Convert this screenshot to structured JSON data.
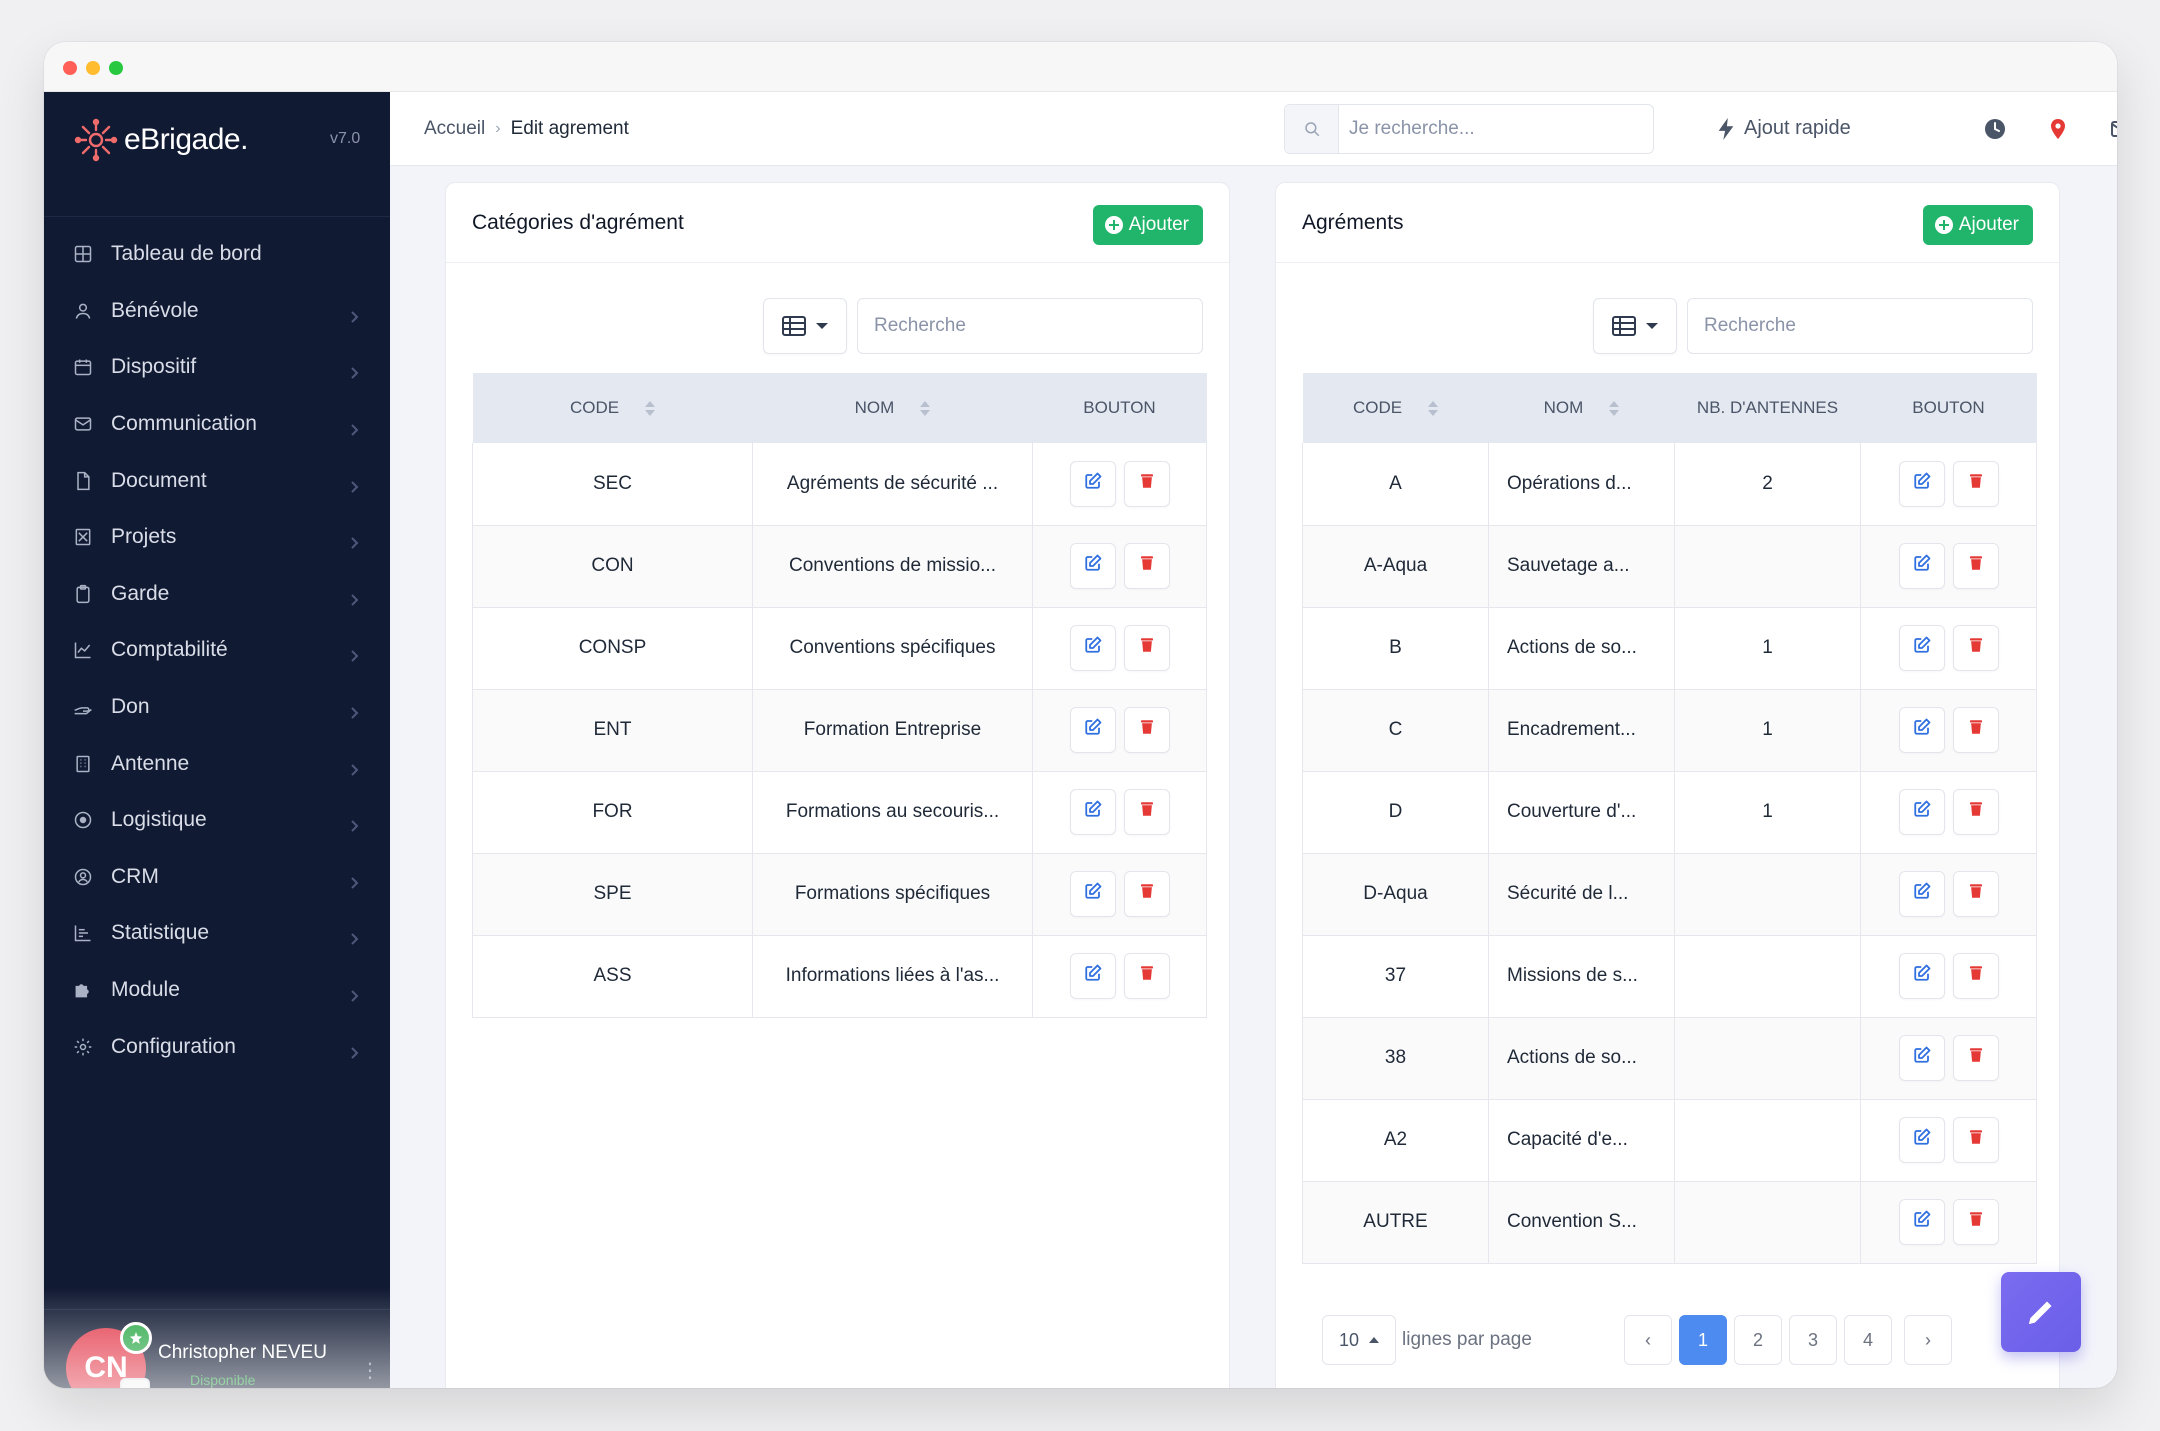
{
  "app": {
    "name": "eBrigade.",
    "version": "v7.0"
  },
  "sidebar": {
    "items": [
      {
        "label": "Tableau de bord",
        "icon": "dashboard-icon",
        "chevron": false
      },
      {
        "label": "Bénévole",
        "icon": "user-icon",
        "chevron": true
      },
      {
        "label": "Dispositif",
        "icon": "calendar-icon",
        "chevron": true
      },
      {
        "label": "Communication",
        "icon": "mail-icon",
        "chevron": true
      },
      {
        "label": "Document",
        "icon": "file-icon",
        "chevron": true
      },
      {
        "label": "Projets",
        "icon": "project-icon",
        "chevron": true
      },
      {
        "label": "Garde",
        "icon": "clipboard-icon",
        "chevron": true
      },
      {
        "label": "Comptabilité",
        "icon": "chart-line-icon",
        "chevron": true
      },
      {
        "label": "Don",
        "icon": "hand-icon",
        "chevron": true
      },
      {
        "label": "Antenne",
        "icon": "building-icon",
        "chevron": true
      },
      {
        "label": "Logistique",
        "icon": "target-icon",
        "chevron": true
      },
      {
        "label": "CRM",
        "icon": "contact-icon",
        "chevron": true
      },
      {
        "label": "Statistique",
        "icon": "stats-icon",
        "chevron": true
      },
      {
        "label": "Module",
        "icon": "puzzle-icon",
        "chevron": true
      },
      {
        "label": "Configuration",
        "icon": "gear-icon",
        "chevron": true
      }
    ],
    "user": {
      "initials": "CN",
      "name": "Christopher NEVEU",
      "status": "Disponible"
    }
  },
  "topbar": {
    "breadcrumb": {
      "home": "Accueil",
      "separator": "›",
      "current": "Edit agrement"
    },
    "search_placeholder": "Je recherche...",
    "quick_add": "Ajout rapide"
  },
  "left_panel": {
    "title": "Catégories d'agrément",
    "add_label": "Ajouter",
    "search_placeholder": "Recherche",
    "columns": [
      "CODE",
      "NOM",
      "BOUTON"
    ],
    "rows": [
      {
        "code": "SEC",
        "nom": "Agréments de sécurité ..."
      },
      {
        "code": "CON",
        "nom": "Conventions de missio..."
      },
      {
        "code": "CONSP",
        "nom": "Conventions spécifiques"
      },
      {
        "code": "ENT",
        "nom": "Formation Entreprise"
      },
      {
        "code": "FOR",
        "nom": "Formations au secouris..."
      },
      {
        "code": "SPE",
        "nom": "Formations spécifiques"
      },
      {
        "code": "ASS",
        "nom": "Informations liées à l'as..."
      }
    ]
  },
  "right_panel": {
    "title": "Agréments",
    "add_label": "Ajouter",
    "search_placeholder": "Recherche",
    "columns": [
      "CODE",
      "NOM",
      "NB. D'ANTENNES",
      "BOUTON"
    ],
    "rows": [
      {
        "code": "A",
        "nom": "Opérations d...",
        "antennes": "2"
      },
      {
        "code": "A-Aqua",
        "nom": "Sauvetage a...",
        "antennes": ""
      },
      {
        "code": "B",
        "nom": "Actions de so...",
        "antennes": "1"
      },
      {
        "code": "C",
        "nom": "Encadrement...",
        "antennes": "1"
      },
      {
        "code": "D",
        "nom": "Couverture d'...",
        "antennes": "1"
      },
      {
        "code": "D-Aqua",
        "nom": "Sécurité de l...",
        "antennes": ""
      },
      {
        "code": "37",
        "nom": "Missions de s...",
        "antennes": ""
      },
      {
        "code": "38",
        "nom": "Actions de so...",
        "antennes": ""
      },
      {
        "code": "A2",
        "nom": "Capacité d'e...",
        "antennes": ""
      },
      {
        "code": "AUTRE",
        "nom": "Convention S...",
        "antennes": ""
      }
    ],
    "pagination": {
      "per_page": "10",
      "per_page_label": "lignes par page",
      "prev": "‹",
      "next": "›",
      "pages": [
        "1",
        "2",
        "3",
        "4"
      ],
      "current": "1"
    }
  },
  "colors": {
    "sidebar_bg": "#111a33",
    "accent_green": "#20b56a",
    "edit_blue": "#2f6fe0",
    "delete_red": "#e53935",
    "active_page": "#4d8bf0",
    "fab": "#6a5ee8"
  }
}
